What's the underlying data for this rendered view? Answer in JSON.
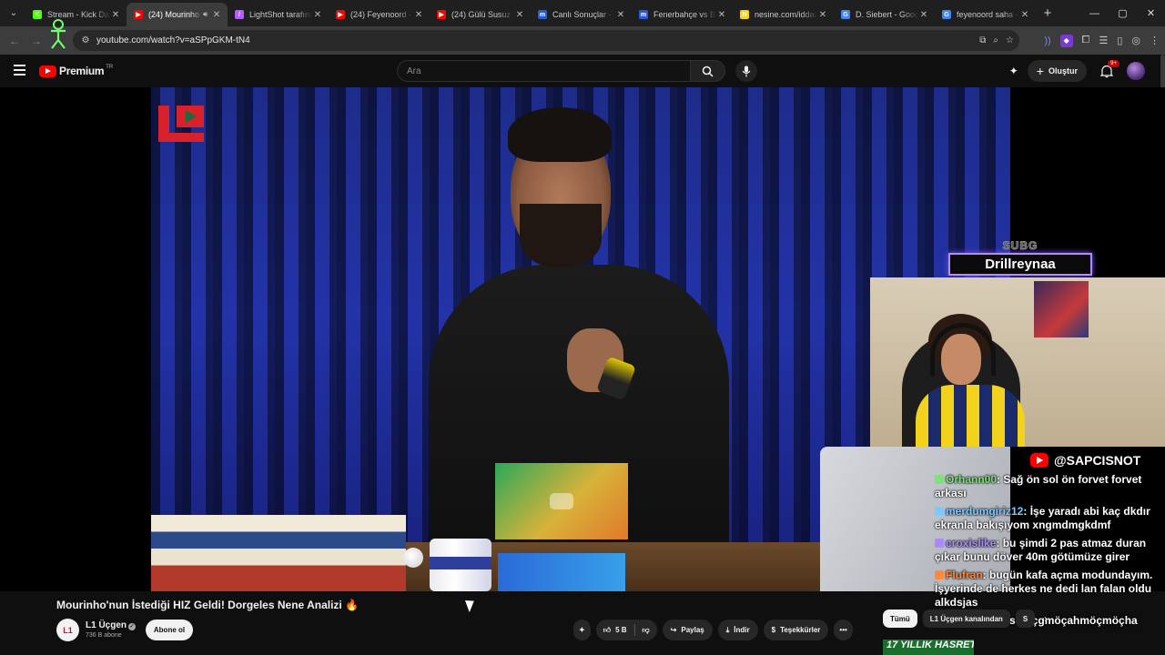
{
  "browser": {
    "tabs": [
      {
        "title": "Stream - Kick Das",
        "favicon_color": "#53fc18",
        "favicon_glyph": "K",
        "active": false
      },
      {
        "title": "(24) Mourinho",
        "favicon_color": "#ff0000",
        "favicon_glyph": "▶",
        "active": true,
        "audio": true
      },
      {
        "title": "LightShot tarafında",
        "favicon_color": "#b45cff",
        "favicon_glyph": "/",
        "active": false
      },
      {
        "title": "(24) Feyenoord -",
        "favicon_color": "#ff0000",
        "favicon_glyph": "▶",
        "active": false
      },
      {
        "title": "(24) Gülü Susuz S",
        "favicon_color": "#ff0000",
        "favicon_glyph": "▶",
        "active": false
      },
      {
        "title": "Canlı Sonuçlar - ",
        "favicon_color": "#2a5bd7",
        "favicon_glyph": "m",
        "active": false
      },
      {
        "title": "Fenerbahçe vs Be",
        "favicon_color": "#2a5bd7",
        "favicon_glyph": "m",
        "active": false
      },
      {
        "title": "nesine.com/iddaa",
        "favicon_color": "#f7d417",
        "favicon_glyph": "N",
        "active": false
      },
      {
        "title": "D. Siebert - Goog",
        "favicon_color": "#4285f4",
        "favicon_glyph": "G",
        "active": false
      },
      {
        "title": "feyenoord saha - ",
        "favicon_color": "#4285f4",
        "favicon_glyph": "G",
        "active": false
      }
    ],
    "url": "youtube.com/watch?v=aSPpGKM-tN4"
  },
  "youtube": {
    "logo_word": "Premium",
    "logo_region": "TR",
    "search_placeholder": "Ara",
    "create_label": "Oluştur",
    "notif_badge": "9+"
  },
  "video": {
    "title": "Mourinho'nun İstediği HIZ Geldi! Dorgeles Nene Analizi",
    "title_emoji": "🔥",
    "channel_name": "L1 Üçgen",
    "channel_avatar_text": "L1",
    "subscribers": "736 B abone",
    "subscribe_label": "Abone ol",
    "like_count": "5 B",
    "share_label": "Paylaş",
    "download_label": "İndir",
    "thanks_label": "Teşekkürler"
  },
  "stream_overlay": {
    "sub_goal_title": "SUBG",
    "sub_goal_name": "Drillreynaa",
    "handle": "@SAPCISNOT",
    "chat": [
      {
        "user": "Orhann00",
        "text": ": Sağ ön sol ön forvet forvet arkası",
        "color": "#7ee07e"
      },
      {
        "user": "merdumgiriz12",
        "text": ": İşe yaradı abi kaç dkdır ekranla bakışıyom xngmdmgkdmf",
        "color": "#7ec8ff"
      },
      {
        "user": "croxislike",
        "text": ": bu şimdi 2 pas atmaz duran çıkar bunu döver 40m götümüze girer",
        "color": "#a88cff"
      },
      {
        "user": "Flufran",
        "text": ": bugün kafa açma modundayım. İşyerinde de herkes ne dedi lan falan oldu alkdsjas",
        "color": "#ff8a3a"
      },
      {
        "user": "Orhann00",
        "text": ": asmöçgmöçahmöçmöçha",
        "color": "#7ee07e"
      }
    ],
    "banner_text": "17 YILLIK HASRET"
  },
  "chips": {
    "all": "Tümü",
    "second": "L1 Üçgen kanalından",
    "third": "S"
  }
}
